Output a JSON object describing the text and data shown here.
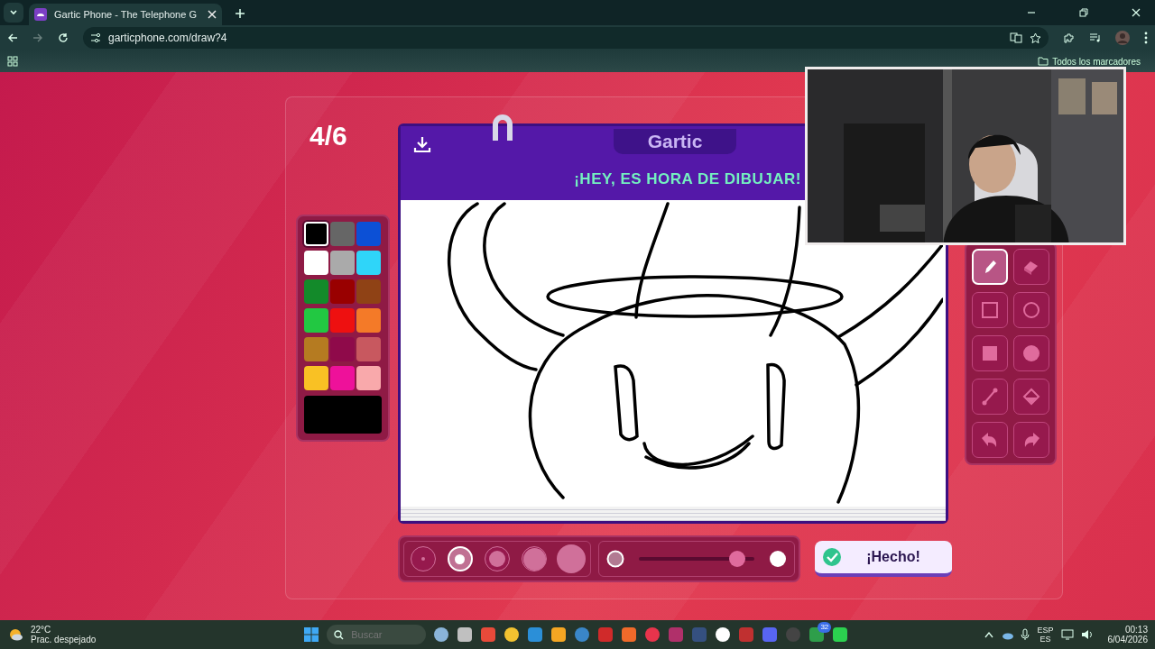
{
  "browser": {
    "tab_title": "Gartic Phone - The Telephone G",
    "address": "garticphone.com/draw?4",
    "bookmarks_label": "Todos los marcadores"
  },
  "game": {
    "round": "4/6",
    "logo": "Gartic",
    "prompt": "¡HEY, ES HORA DE DIBUJAR!",
    "palette": [
      {
        "color": "#000000",
        "selected": true
      },
      {
        "color": "#666666",
        "selected": false
      },
      {
        "color": "#0c50d6",
        "selected": false
      },
      {
        "color": "#ffffff",
        "selected": false
      },
      {
        "color": "#aaaaaa",
        "selected": false
      },
      {
        "color": "#2fd5f9",
        "selected": false
      },
      {
        "color": "#138a2a",
        "selected": false
      },
      {
        "color": "#990000",
        "selected": false
      },
      {
        "color": "#8f4215",
        "selected": false
      },
      {
        "color": "#22c842",
        "selected": false
      },
      {
        "color": "#ee1010",
        "selected": false
      },
      {
        "color": "#f47a28",
        "selected": false
      },
      {
        "color": "#b57b21",
        "selected": false
      },
      {
        "color": "#8f0a4a",
        "selected": false
      },
      {
        "color": "#c8585f",
        "selected": false
      },
      {
        "color": "#f9c124",
        "selected": false
      },
      {
        "color": "#ee119a",
        "selected": false
      },
      {
        "color": "#f9a9ab",
        "selected": false
      }
    ],
    "tools": [
      {
        "kind": "pen",
        "selected": true
      },
      {
        "kind": "eraser",
        "selected": false
      },
      {
        "kind": "rect",
        "selected": false
      },
      {
        "kind": "circle",
        "selected": false
      },
      {
        "kind": "rect-fill",
        "selected": false
      },
      {
        "kind": "circle-fill",
        "selected": false
      },
      {
        "kind": "line",
        "selected": false
      },
      {
        "kind": "bucket",
        "selected": false
      },
      {
        "kind": "undo",
        "selected": false
      },
      {
        "kind": "redo",
        "selected": false
      }
    ],
    "sizes": [
      {
        "selected": false
      },
      {
        "selected": true
      },
      {
        "selected": false
      },
      {
        "selected": false
      },
      {
        "selected": false
      }
    ],
    "opacity": {
      "level": 0.85
    },
    "done_button": "¡Hecho!"
  },
  "taskbar": {
    "temperature": "22°C",
    "weather": "Prac. despejado",
    "search_placeholder": "Buscar",
    "badge": "32",
    "language": "ESP",
    "region": "ES",
    "time": "00:13",
    "date": "6/04/2026"
  }
}
